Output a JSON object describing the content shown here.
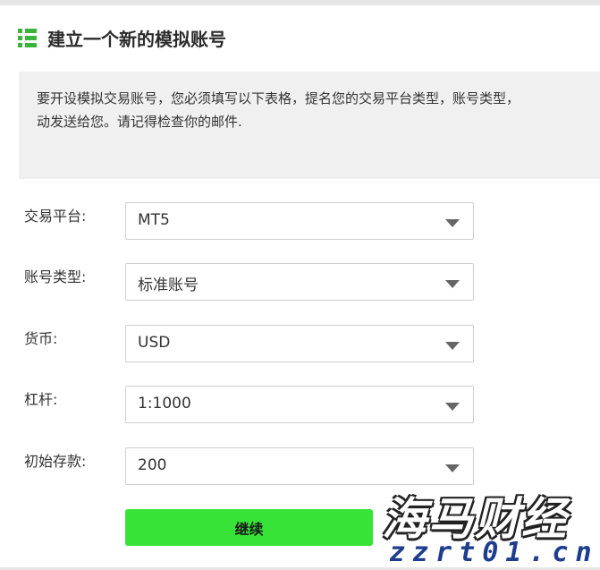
{
  "header": {
    "title": "建立一个新的模拟账号",
    "icon": "list-icon",
    "icon_color": "#3cb43c"
  },
  "notice": {
    "line1": "要开设模拟交易账号，您必须填写以下表格，提名您的交易平台类型，账号类型，",
    "line2": "动发送给您。请记得检查你的邮件."
  },
  "form": {
    "platform": {
      "label": "交易平台:",
      "value": "MT5"
    },
    "account_type": {
      "label": "账号类型:",
      "value": "标准账号"
    },
    "currency": {
      "label": "货币:",
      "value": "USD"
    },
    "leverage": {
      "label": "杠杆:",
      "value": "1:1000"
    },
    "deposit": {
      "label": "初始存款:",
      "value": "200"
    }
  },
  "continue_button": {
    "label": "继续",
    "color": "#36e336"
  },
  "watermark": {
    "title": "海马财经",
    "url": "zzrt01.cn"
  }
}
